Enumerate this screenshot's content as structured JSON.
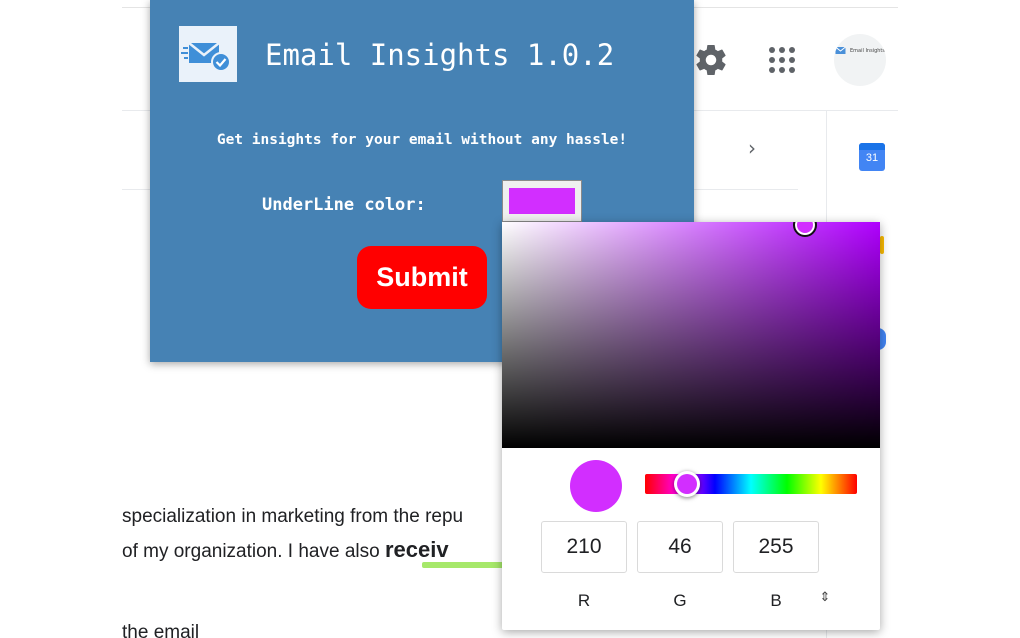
{
  "popup": {
    "title": "Email Insights 1.0.2",
    "subtitle": "Get insights for your email without any hassle!",
    "underline_label": "UnderLine color:",
    "submit_label": "Submit",
    "icon": "mail-check-icon",
    "bg_color": "#4682b4",
    "submit_color": "#ff0000"
  },
  "picker": {
    "r": "210",
    "g": "46",
    "b": "255",
    "r_label": "R",
    "g_label": "G",
    "b_label": "B",
    "toggle_symbol": "⇕",
    "selected_color": "#d22eff",
    "hue_color": "#b000ff"
  },
  "email": {
    "line1": "specialization in marketing from the repu",
    "line2_prefix": "of my organization. I have also ",
    "keyword": "receiv",
    "line3": "the email",
    "underline_color": "#a6e86a"
  },
  "toolbar": {
    "settings_icon": "gear-icon",
    "apps_icon": "apps-grid-icon",
    "avatar_text": "Email Insights",
    "calendar_day": "31",
    "chev_left": "‹",
    "chev_right": "›"
  }
}
